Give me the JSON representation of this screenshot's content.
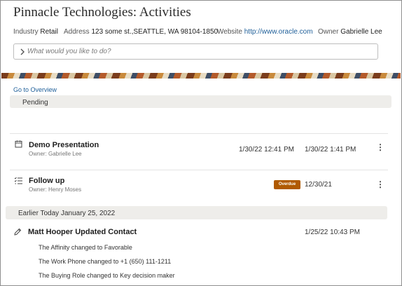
{
  "page": {
    "title": "Pinnacle Technologies: Activities"
  },
  "info": {
    "industry_label": "Industry",
    "industry_value": "Retail",
    "address_label": "Address",
    "address_value": "123 some st.,SEATTLE, WA 98104-1850",
    "website_label": "Website",
    "website_value": "http://www.oracle.com",
    "owner_label": "Owner",
    "owner_value": "Gabrielle Lee"
  },
  "search": {
    "placeholder": "What would you like to do?",
    "icon": "chevron-right-icon"
  },
  "overview_link": "Go to Overview",
  "pending": {
    "header": "Pending",
    "activities": [
      {
        "icon": "calendar-icon",
        "title": "Demo Presentation",
        "owner": "Owner: Gabrielle Lee",
        "start": "1/30/22 12:41 PM",
        "end": "1/30/22 1:41 PM"
      },
      {
        "icon": "task-list-icon",
        "title": "Follow up",
        "owner": "Owner: Henry Moses",
        "badge": "Overdue",
        "due": "12/30/21"
      }
    ]
  },
  "earlier": {
    "header": "Earlier Today January 25, 2022",
    "entry": {
      "icon": "pencil-icon",
      "title": "Matt Hooper Updated Contact",
      "time": "1/25/22 10:43 PM",
      "changes": [
        "The Affinity changed to Favorable",
        "The Work Phone changed to +1 (650) 111-1211",
        "The Buying Role changed to Key decision maker"
      ]
    }
  },
  "colors": {
    "link": "#1f5f99",
    "overdue_badge": "#b05a00",
    "section_bg": "#eeedea"
  }
}
